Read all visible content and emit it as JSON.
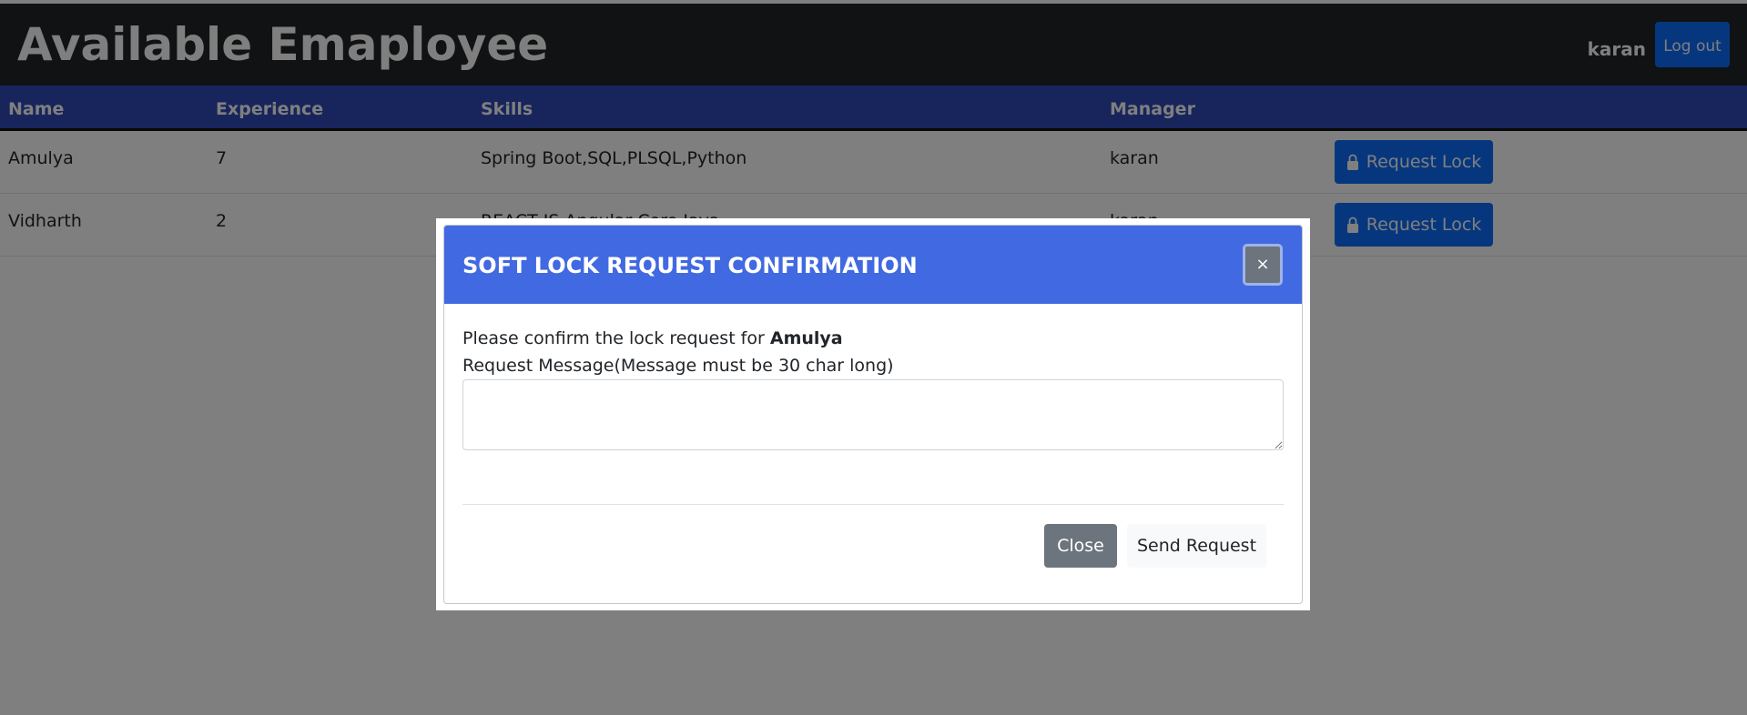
{
  "header": {
    "title": "Available Emaployee",
    "user": "karan",
    "logout_label": "Log out"
  },
  "table": {
    "columns": [
      "Name",
      "Experience",
      "Skills",
      "Manager"
    ],
    "rows": [
      {
        "name": "Amulya",
        "experience": "7",
        "skills": "Spring Boot,SQL,PLSQL,Python",
        "manager": "karan",
        "action": "Request Lock"
      },
      {
        "name": "Vidharth",
        "experience": "2",
        "skills": "REACT JS,Angular,Core Java",
        "manager": "karan",
        "action": "Request Lock"
      }
    ]
  },
  "modal": {
    "title": "SOFT LOCK REQUEST CONFIRMATION",
    "close_symbol": "×",
    "confirm_text": "Please confirm the lock request for",
    "employee_name": "Amulya",
    "message_label": "Request Message(Message must be 30 char long)",
    "message_value": "",
    "close_label": "Close",
    "send_label": "Send Request"
  },
  "icons": {
    "request_button_icon": "lock-icon"
  },
  "colors": {
    "topbar": "#212529",
    "table_header": "#2e4ab8",
    "primary_button": "#0d6efd",
    "modal_header": "#4169e1",
    "secondary_button": "#6c757d",
    "light_button": "#f8f9fa"
  }
}
